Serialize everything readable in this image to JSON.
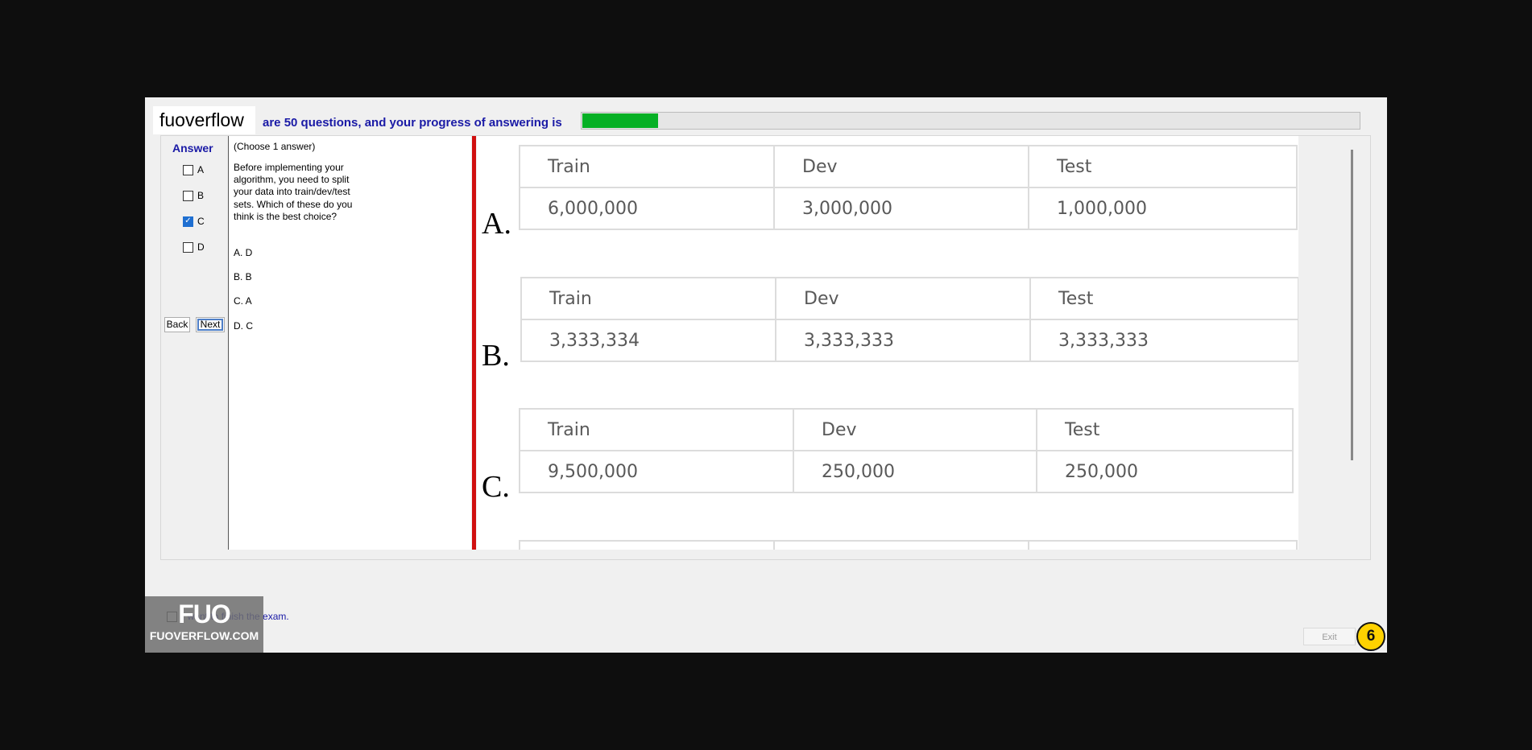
{
  "brand": "fuoverflow",
  "progress": {
    "text": "are 50 questions, and your progress of answering is",
    "fraction": 0.098
  },
  "answer": {
    "heading": "Answer",
    "options": [
      {
        "label": "A",
        "checked": false
      },
      {
        "label": "B",
        "checked": false
      },
      {
        "label": "C",
        "checked": true
      },
      {
        "label": "D",
        "checked": false
      }
    ],
    "back_label": "Back",
    "next_label": "Next"
  },
  "question": {
    "instruction": "(Choose 1 answer)",
    "lines": [
      "Before implementing your",
      "algorithm, you need to split",
      "your data into train/dev/test",
      "sets. Which of these do you",
      "think is the best choice?"
    ],
    "choices": [
      "A.  D",
      "B.  B",
      "C.  A",
      "D.  C"
    ]
  },
  "image": {
    "options": [
      {
        "letter": "A.",
        "headers": [
          "Train",
          "Dev",
          "Test"
        ],
        "values": [
          "6,000,000",
          "3,000,000",
          "1,000,000"
        ]
      },
      {
        "letter": "B.",
        "headers": [
          "Train",
          "Dev",
          "Test"
        ],
        "values": [
          "3,333,334",
          "3,333,333",
          "3,333,333"
        ]
      },
      {
        "letter": "C.",
        "headers": [
          "Train",
          "Dev",
          "Test"
        ],
        "values": [
          "9,500,000",
          "250,000",
          "250,000"
        ]
      }
    ]
  },
  "footer": {
    "finish_label": "I want to finish the exam.",
    "logo_mark": "FUO",
    "logo_text": "FUOVERFLOW.COM",
    "exit_label": "Exit",
    "badge": "6"
  }
}
